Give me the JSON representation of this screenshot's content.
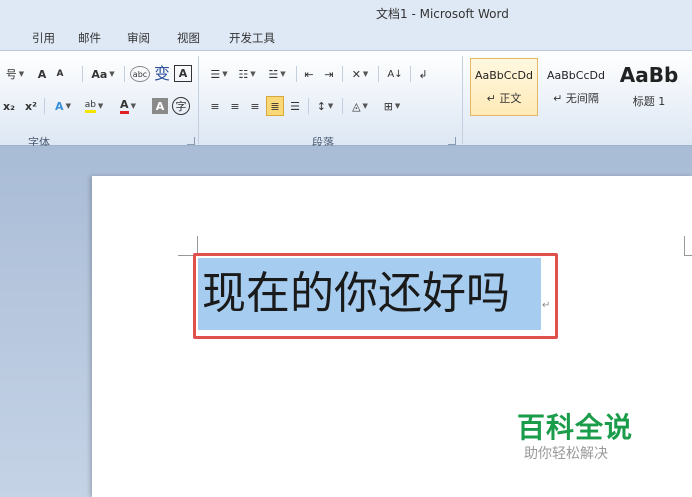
{
  "window": {
    "title": "文档1 - Microsoft Word"
  },
  "tabs": [
    "引用",
    "邮件",
    "审阅",
    "视图",
    "开发工具"
  ],
  "font_group": {
    "label": "字体",
    "row1": {
      "size_suffix": "号",
      "grow": "A",
      "shrink": "A",
      "case": "Aa",
      "phonetic": "abc",
      "charborder": "A"
    },
    "row2": {
      "sub": "x₂",
      "sup": "x²",
      "effects": "A",
      "highlight": "ab",
      "fontcolor": "A",
      "shade": "A",
      "enclose": "字"
    }
  },
  "paragraph_group": {
    "label": "段落",
    "sort": "A↓"
  },
  "styles_group": {
    "items": [
      {
        "sample": "AaBbCcDd",
        "name": "↵ 正文"
      },
      {
        "sample": "AaBbCcDd",
        "name": "↵ 无间隔"
      },
      {
        "sample": "AaBb",
        "name": "标题 1"
      }
    ]
  },
  "document": {
    "selected_text": "现在的你还好吗"
  },
  "watermark": {
    "title": "百科全说",
    "subtitle": "助你轻松解决"
  },
  "colors": {
    "highlight_frame": "#e0504d",
    "selection": "#a6cdf0",
    "watermark": "#1a9c4a"
  }
}
